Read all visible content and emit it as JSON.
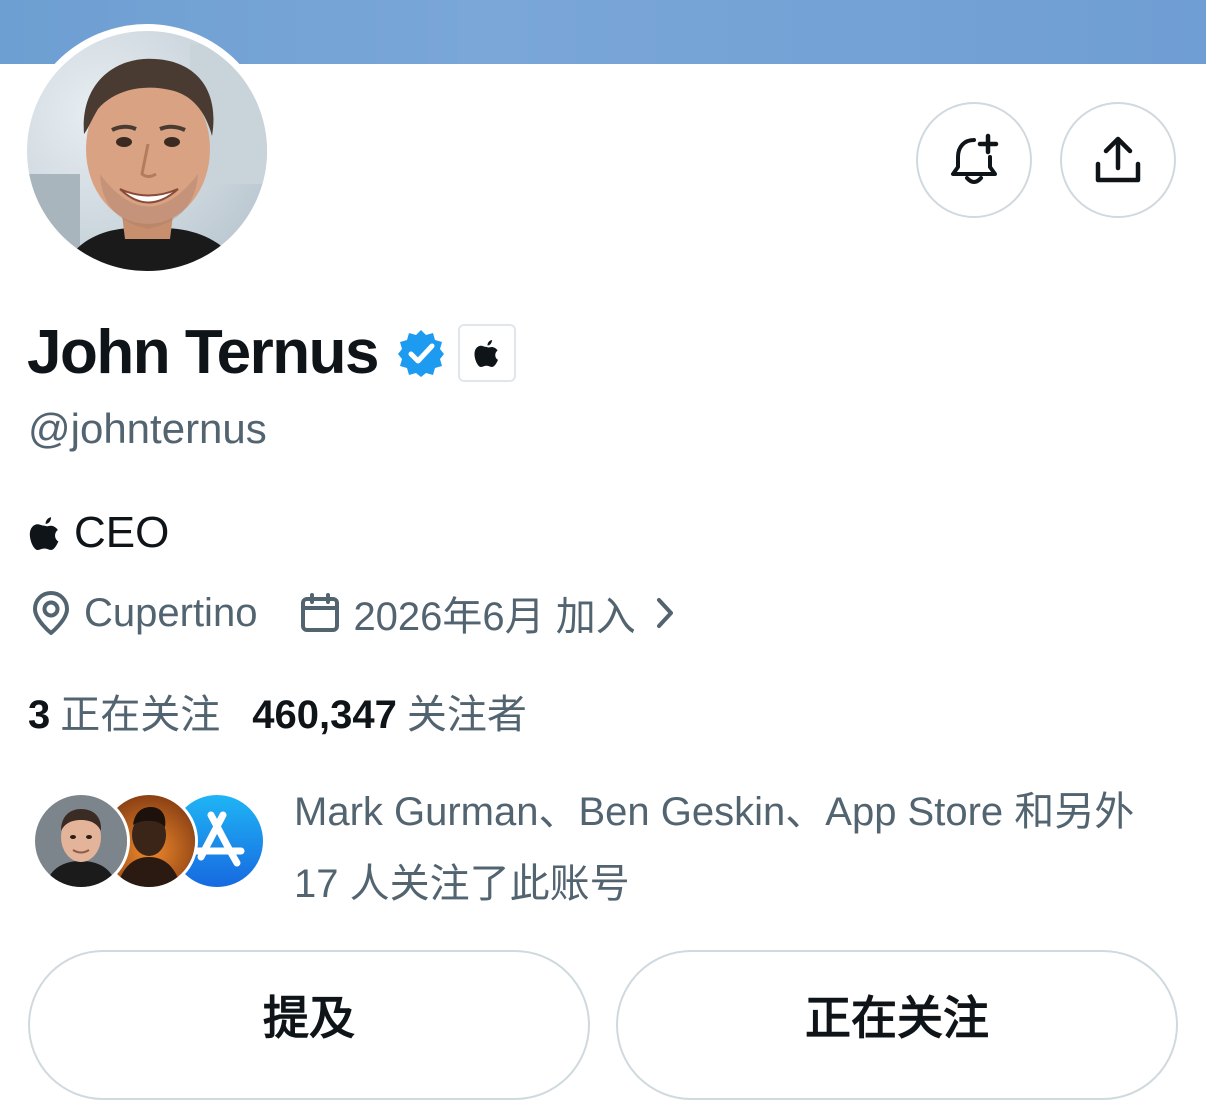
{
  "profile": {
    "display_name": "John Ternus",
    "handle": "@johnternus",
    "verified": true,
    "affiliation_badge_icon": "apple-logo-icon",
    "bio_text": "CEO",
    "bio_icon": "apple-logo-icon",
    "location": "Cupertino",
    "location_icon": "location-pin-icon",
    "joined": "2026年6月 加入",
    "joined_icon": "calendar-icon"
  },
  "header_actions": {
    "notify_icon": "bell-plus-icon",
    "share_icon": "share-icon"
  },
  "stats": {
    "following_count": "3",
    "following_label": "正在关注",
    "followers_count": "460,347",
    "followers_label": "关注者"
  },
  "followers_you_know": {
    "text": "Mark Gurman、Ben Geskin、App Store 和另外 17 人关注了此账号"
  },
  "buttons": {
    "mention_label": "提及",
    "following_label": "正在关注"
  },
  "colors": {
    "banner": "#6e9fd2",
    "verified_blue": "#1d9bf0",
    "secondary_text": "#536471",
    "primary_text": "#0f1419",
    "border": "#cfd9de"
  }
}
